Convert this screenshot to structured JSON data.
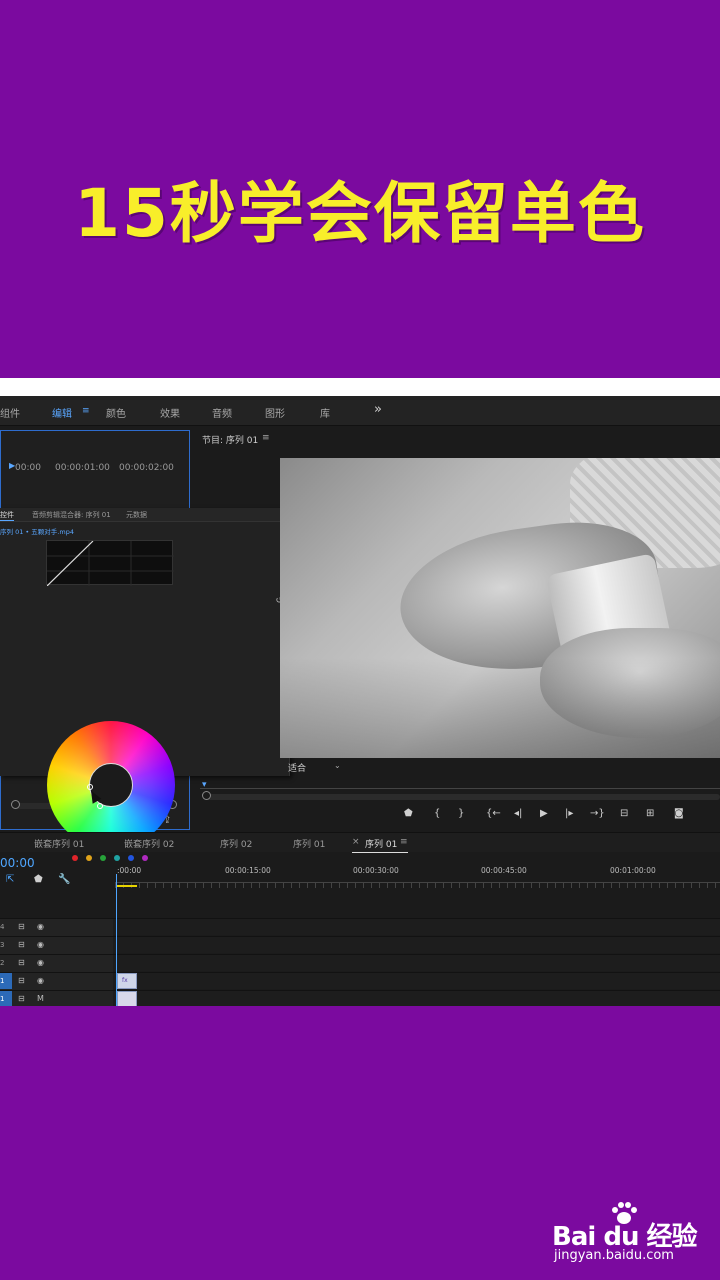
{
  "banner": {
    "title": "15秒学会保留单色"
  },
  "workspace_tabs": [
    {
      "label": "组件",
      "active": false
    },
    {
      "label": "编辑",
      "active": true
    },
    {
      "label": "颜色",
      "active": false
    },
    {
      "label": "效果",
      "active": false
    },
    {
      "label": "音频",
      "active": false
    },
    {
      "label": "图形",
      "active": false
    },
    {
      "label": "库",
      "active": false
    }
  ],
  "workspace_menu_icon": "hamburger-icon",
  "workspace_more": "»",
  "source": {
    "timecodes": [
      "00:00",
      "00:00:01:00",
      "00:00:02:00"
    ]
  },
  "lumetri": {
    "tabs": [
      "控件",
      "音频剪辑混合器: 序列 01",
      "元数据"
    ],
    "clip_line": "序列 01 • 五颗对手.mp4",
    "swatch_colors": [
      "#e0242a",
      "#e0a31a",
      "#27a33a",
      "#20a3a3",
      "#2255e0",
      "#b02ac0"
    ]
  },
  "program": {
    "title": "节目: 序列 01",
    "fit_label": "适合",
    "controls": [
      "marker-icon",
      "mark-in-icon",
      "mark-out-icon",
      "go-to-in-icon",
      "step-back-icon",
      "play-icon",
      "step-forward-icon",
      "go-to-out-icon",
      "lift-icon",
      "extract-icon",
      "camera-icon"
    ]
  },
  "timeline": {
    "tabs": [
      {
        "label": "嵌套序列 01",
        "active": false
      },
      {
        "label": "嵌套序列 02",
        "active": false
      },
      {
        "label": "序列 02",
        "active": false
      },
      {
        "label": "序列 01",
        "active": false
      },
      {
        "label": "序列 01",
        "active": true,
        "closable": true
      }
    ],
    "current_time": "00:00",
    "ruler": [
      ":00:00",
      "00:00:15:00",
      "00:00:30:00",
      "00:00:45:00",
      "00:01:00:00"
    ],
    "tracks": [
      "4",
      "3",
      "2",
      "1",
      "1"
    ],
    "clip_label": "fx"
  },
  "watermark": {
    "logo": "Bai du 经验",
    "url": "jingyan.baidu.com"
  }
}
